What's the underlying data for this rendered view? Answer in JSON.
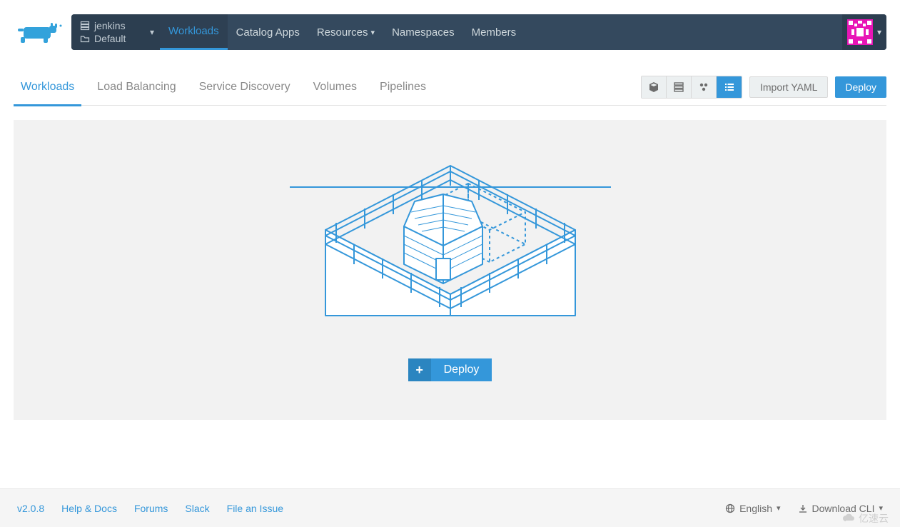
{
  "header": {
    "project_name": "jenkins",
    "namespace_name": "Default",
    "nav": [
      {
        "label": "Workloads",
        "active": true,
        "has_dropdown": false
      },
      {
        "label": "Catalog Apps",
        "active": false,
        "has_dropdown": false
      },
      {
        "label": "Resources",
        "active": false,
        "has_dropdown": true
      },
      {
        "label": "Namespaces",
        "active": false,
        "has_dropdown": false
      },
      {
        "label": "Members",
        "active": false,
        "has_dropdown": false
      }
    ]
  },
  "subbar": {
    "tabs": [
      {
        "label": "Workloads",
        "active": true
      },
      {
        "label": "Load Balancing",
        "active": false
      },
      {
        "label": "Service Discovery",
        "active": false
      },
      {
        "label": "Volumes",
        "active": false
      },
      {
        "label": "Pipelines",
        "active": false
      }
    ],
    "view_buttons": [
      {
        "name": "view-flat",
        "active": false,
        "icon": "cube"
      },
      {
        "name": "view-stack",
        "active": false,
        "icon": "stack"
      },
      {
        "name": "view-pods",
        "active": false,
        "icon": "pods"
      },
      {
        "name": "view-list",
        "active": true,
        "icon": "list"
      }
    ],
    "import_label": "Import YAML",
    "deploy_label": "Deploy"
  },
  "empty_state": {
    "deploy_cta_label": "Deploy"
  },
  "footer": {
    "version": "v2.0.8",
    "links": [
      {
        "label": "Help & Docs"
      },
      {
        "label": "Forums"
      },
      {
        "label": "Slack"
      },
      {
        "label": "File an Issue"
      }
    ],
    "language": "English",
    "download_label": "Download CLI"
  },
  "watermark": "亿速云",
  "colors": {
    "accent": "#3497da",
    "header_bg": "#34495e",
    "header_dark": "#2c3e50",
    "avatar_bg": "#e815b6"
  }
}
